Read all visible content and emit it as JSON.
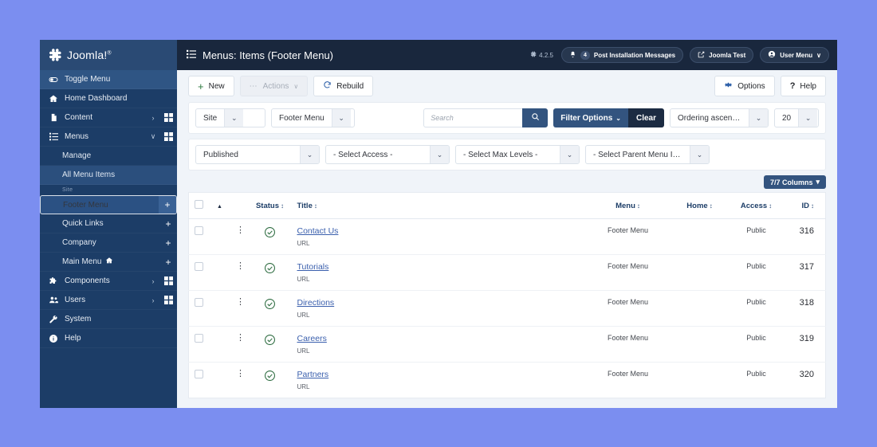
{
  "sidebar": {
    "brand": {
      "name": "Joomla!",
      "trademark": "®",
      "logo_icon": "joomla-logo-icon"
    },
    "toggle": {
      "label": "Toggle Menu",
      "icon": "toggle-menu-icon"
    },
    "items": [
      {
        "label": "Home Dashboard",
        "icon": "home-icon",
        "chevron": "",
        "grid": false
      },
      {
        "label": "Content",
        "icon": "content-icon",
        "chevron": "›",
        "grid": true
      },
      {
        "label": "Menus",
        "icon": "menus-icon",
        "chevron": "∨",
        "grid": true
      }
    ],
    "menus_sub": [
      {
        "label": "Manage",
        "highlight": false
      },
      {
        "label": "All Menu Items",
        "highlight": true
      }
    ],
    "group_label": "Site",
    "site_menus": [
      {
        "label": "Footer Menu",
        "selected": true,
        "add": "+",
        "home": false
      },
      {
        "label": "Quick Links",
        "selected": false,
        "add": "+",
        "home": false
      },
      {
        "label": "Company",
        "selected": false,
        "add": "+",
        "home": false
      },
      {
        "label": "Main Menu",
        "selected": false,
        "add": "+",
        "home": true
      }
    ],
    "items_bottom": [
      {
        "label": "Components",
        "icon": "components-icon",
        "chevron": "›",
        "grid": true
      },
      {
        "label": "Users",
        "icon": "users-icon",
        "chevron": "›",
        "grid": true
      },
      {
        "label": "System",
        "icon": "wrench-icon",
        "chevron": "",
        "grid": false
      },
      {
        "label": "Help",
        "icon": "info-icon",
        "chevron": "",
        "grid": false
      }
    ]
  },
  "topbar": {
    "title": "Menus: Items (Footer Menu)",
    "title_icon": "list-icon",
    "version": "4.2.5",
    "version_icon": "joomla-mark-icon",
    "messages": {
      "label": "Post Installation Messages",
      "count": "4",
      "icon": "bell-icon"
    },
    "site": {
      "label": "Joomla Test",
      "icon": "external-link-icon"
    },
    "user": {
      "label": "User Menu",
      "icon": "user-circle-icon",
      "chevron": "∨"
    }
  },
  "toolbar": {
    "new": {
      "label": "New",
      "icon": "plus-icon"
    },
    "actions": {
      "label": "Actions",
      "icon": "ellipsis-icon",
      "chevron": "∨"
    },
    "rebuild": {
      "label": "Rebuild",
      "icon": "refresh-icon"
    },
    "options": {
      "label": "Options",
      "icon": "gear-icon"
    },
    "help": {
      "label": "Help",
      "icon": "question-icon"
    }
  },
  "filters": {
    "row1": {
      "site_select": "Site",
      "menu_select": "Footer Menu",
      "search_placeholder": "Search",
      "search_value": "",
      "search_icon": "search-icon",
      "filter_options": "Filter Options",
      "clear": "Clear",
      "ordering": "Ordering ascending",
      "limit": "20"
    },
    "row2": {
      "status": "Published",
      "access": "- Select Access -",
      "max_levels": "- Select Max Levels -",
      "parent": "- Select Parent Menu Item -"
    },
    "columns_button": "7/7 Columns"
  },
  "table": {
    "headers": {
      "checkbox": "",
      "ordering": "▲",
      "actions": "",
      "status": "Status",
      "title": "Title",
      "menu": "Menu",
      "home": "Home",
      "access": "Access",
      "id": "ID"
    },
    "sort_glyph": "↕",
    "rows": [
      {
        "status_icon": "check-circle-icon",
        "title": "Contact Us",
        "type": "URL",
        "menu": "Footer Menu",
        "home": "",
        "access": "Public",
        "id": "316"
      },
      {
        "status_icon": "check-circle-icon",
        "title": "Tutorials",
        "type": "URL",
        "menu": "Footer Menu",
        "home": "",
        "access": "Public",
        "id": "317"
      },
      {
        "status_icon": "check-circle-icon",
        "title": "Directions",
        "type": "URL",
        "menu": "Footer Menu",
        "home": "",
        "access": "Public",
        "id": "318"
      },
      {
        "status_icon": "check-circle-icon",
        "title": "Careers",
        "type": "URL",
        "menu": "Footer Menu",
        "home": "",
        "access": "Public",
        "id": "319"
      },
      {
        "status_icon": "check-circle-icon",
        "title": "Partners",
        "type": "URL",
        "menu": "Footer Menu",
        "home": "",
        "access": "Public",
        "id": "320"
      }
    ]
  },
  "colors": {
    "sidebar_bg": "#1c3d67",
    "topbar_bg": "#19273d",
    "accent": "#33547f",
    "link": "#3a5fad",
    "published_green": "#2c6b3f",
    "page_bg": "#7b8ef0"
  }
}
